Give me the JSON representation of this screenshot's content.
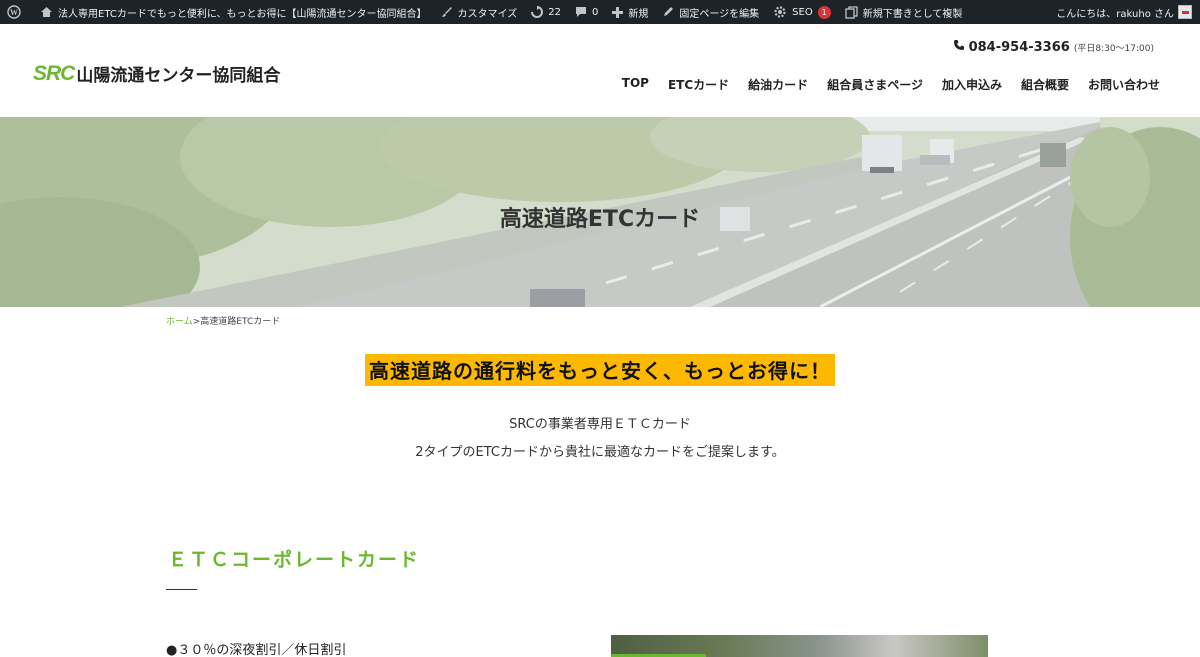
{
  "adminbar": {
    "site_title": "法人専用ETCカードでもっと便利に、もっとお得に【山陽流通センター協同組合】",
    "customize": "カスタマイズ",
    "updates_count": "22",
    "comments_count": "0",
    "new": "新規",
    "edit_page": "固定ページを編集",
    "seo": "SEO",
    "seo_badge": "1",
    "duplicate_draft": "新規下書きとして複製",
    "greeting": "こんにちは、rakuho さん"
  },
  "header": {
    "logo_mark": "SRC",
    "logo_text": "山陽流通センター協同組合",
    "phone": "084-954-3366",
    "phone_hours": "(平日8:30～17:00)",
    "nav": [
      "TOP",
      "ETCカード",
      "給油カード",
      "組合員さまページ",
      "加入申込み",
      "組合概要",
      "お問い合わせ"
    ]
  },
  "hero": {
    "title": "高速道路ETCカード"
  },
  "breadcrumb": {
    "home": "ホーム",
    "separator": ">",
    "current": "高速道路ETCカード"
  },
  "main": {
    "headline": "高速道路の通行料をもっと安く、もっとお得に！",
    "intro_line1": "SRCの事業者専用ＥＴＣカード",
    "intro_line2": "2タイプのETCカードから貴社に最適なカードをご提案します。",
    "section_title": "ＥＴＣコーポレートカード",
    "feature_1": "●３０％の深夜割引／休日割引"
  },
  "colors": {
    "brand_green": "#6bb82e",
    "highlight": "#fcb900",
    "adminbar": "#1d2327"
  }
}
